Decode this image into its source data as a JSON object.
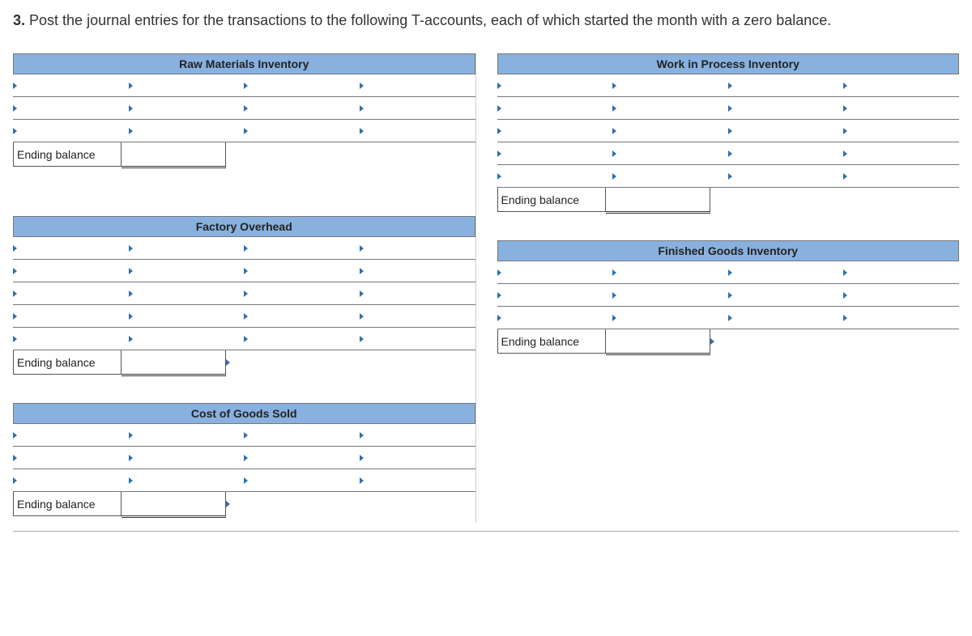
{
  "question": {
    "number": "3.",
    "text": "Post the journal entries for the transactions to the following T-accounts, each of which started the month with a zero balance."
  },
  "labels": {
    "ending_balance": "Ending balance"
  },
  "accounts": {
    "raw_materials": "Raw Materials Inventory",
    "work_in_process": "Work in Process Inventory",
    "factory_overhead": "Factory Overhead",
    "finished_goods": "Finished Goods Inventory",
    "cogs": "Cost of Goods Sold"
  }
}
